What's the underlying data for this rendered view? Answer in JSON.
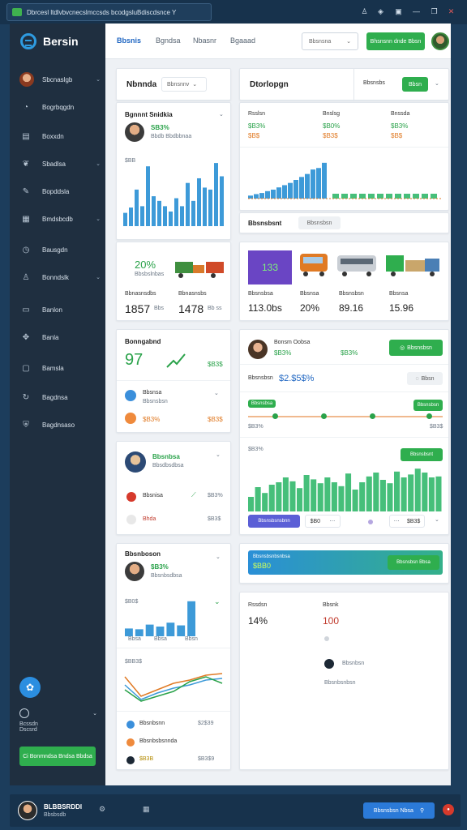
{
  "window": {
    "title": "Dbrcesl ltdlvbvcnecslmccsds bcodgsluBdiscdsnce Y",
    "icons": [
      "person-icon",
      "notification-icon",
      "app-icon",
      "restore-icon",
      "close-icon"
    ]
  },
  "sidebar": {
    "brand": "Bersin",
    "items": [
      {
        "label": "Sbcnaslgb",
        "icon": "avatar",
        "chevron": true
      },
      {
        "label": "Bogrbqgdn",
        "icon": "pie-icon",
        "chevron": false
      },
      {
        "label": "Boxxdn",
        "icon": "doc-icon",
        "chevron": false
      },
      {
        "label": "Sbadlsa",
        "icon": "leaf-icon",
        "chevron": true
      },
      {
        "label": "Bopddsla",
        "icon": "pen-icon",
        "chevron": false
      },
      {
        "label": "Bmdsbcdb",
        "icon": "grid-icon",
        "chevron": true
      },
      {
        "label": "Bausgdn",
        "icon": "clock-icon",
        "chevron": false
      },
      {
        "label": "Bonndslk",
        "icon": "user-icon",
        "chevron": true
      },
      {
        "label": "Banlon",
        "icon": "table-icon",
        "chevron": false
      },
      {
        "label": "Banla",
        "icon": "puzzle-icon",
        "chevron": false
      },
      {
        "label": "Bamsla",
        "icon": "chat-icon",
        "chevron": false
      },
      {
        "label": "Bagdnsa",
        "icon": "refresh-icon",
        "chevron": false
      },
      {
        "label": "Bagdnsaso",
        "icon": "shield-icon",
        "chevron": false
      }
    ],
    "bottom_label": "Bcssdn\nDscsrd",
    "bottom_button": "Ci Bonmndsa Bndsa Bbdsa"
  },
  "topbar": {
    "tabs": [
      "Bbsnis",
      "Bgndsa",
      "Nbasnr",
      "Bgaaad"
    ],
    "select_value": "Bbsnsna",
    "action_button": "Bhsnsnn dnde Bbsn"
  },
  "c1": {
    "title": "Nbnnda",
    "select": "Bbnsnnv"
  },
  "c2": {
    "title": "Bgnnnt Snidkia",
    "pct": "SB3%",
    "sub": "Bbdb Bbdbbnaa",
    "chart_label": "$BB"
  },
  "c3": {
    "pct": "20%",
    "sub": "Bbsbslnbas",
    "l1": "Bbnasnsdbs",
    "v1": "1857",
    "u1": "Bbs",
    "l2": "Bbnasnsbs",
    "v2": "1478",
    "u2": "Bb ss"
  },
  "c4": {
    "title": "Bonngabnd",
    "value": "97",
    "right": "$B3$"
  },
  "c4a": {
    "l1": "Bbsnsa",
    "s1": "Bbsnsbsn",
    "l2": "$B3%",
    "v2": "$B3$"
  },
  "c5": {
    "title": "Bbsnbsa",
    "sub": "Bbsdbsdbsa",
    "l1": "Bbsnisa",
    "v1": "$B3%",
    "l2": "Bhda",
    "v2": "$B3$"
  },
  "c6": {
    "title": "Bbsnboson",
    "pct": "$B3%",
    "sub": "Bbsnbsdbsa",
    "chart_label": "$B0$",
    "x1": "Bbsa",
    "x2": "Bbsa",
    "x3": "Bbsn"
  },
  "c6b": {
    "label": "$BB3$",
    "r1": "Bbsnbsnn",
    "v1": "$2$39",
    "r2": "Bbsnbsbsnnda",
    "v2": "$B3$9",
    "r3": "$B3B",
    "v3": "$B3$9"
  },
  "d1": {
    "title": "Dtorlopgn",
    "s1": "Bbsnsbs",
    "s2": "Bbsn"
  },
  "d2": {
    "cols": [
      "Rsslsn",
      "Bnslsg",
      "Bnssda"
    ],
    "pcts": [
      "$B3%",
      "$B0%",
      "$B3%"
    ],
    "vals": [
      "$B$",
      "$B3$",
      "$B$"
    ]
  },
  "d3": {
    "tabs": [
      "Bbsnsbsnt",
      "Bbsnsbsn"
    ]
  },
  "d4": {
    "tile": "133",
    "labels": [
      "Bbsnsbsa",
      "Bbsnsa",
      "Bbsnsbsn",
      "Bbsnsa"
    ],
    "vals": [
      "113.0bs",
      "20%",
      "89.16",
      "15.96"
    ],
    "units": [
      "",
      "",
      "",
      ""
    ]
  },
  "d5": {
    "name": "Bonsm Oobsa",
    "pct": "$B3%",
    "pct2": "$B3%",
    "button": "Bbsnsbsn",
    "label": "Bbsnsbsn",
    "value": "$2.$5$%",
    "filter": "Bbsn"
  },
  "d5b": {
    "pill": "Bbsnsbsa",
    "badge": "Bbsnsbsn",
    "l1": "$B3%",
    "l2": "$B3$"
  },
  "d6": {
    "label": "$B3%",
    "badge": "Bbsnsbsnt",
    "chip": "Bbsnsbsnsbnn",
    "v1": "$B0",
    "v2": "$B3$"
  },
  "d7": {
    "label": "Bbsnsbsnbsnbsa",
    "value": "$BB0",
    "button": "Bbsnsbsn Bbsa"
  },
  "d8": {
    "l1": "Rssdsn",
    "v1": "14%",
    "l2": "Bbsnk",
    "v2": "100",
    "r1": "Bbsnbsn",
    "r2": "Bbsnbsnbsn"
  },
  "footer": {
    "name": "BLBBSRDDl",
    "sub": "Bbsbsdb",
    "button": "Bbsnsbsn Nbsa"
  },
  "colors": {
    "accent": "#2fae4e",
    "blue": "#2e8fdb",
    "sidebar": "#1f2f40",
    "bar": "#3d9ad8",
    "green_bar": "#46bf7a"
  }
}
